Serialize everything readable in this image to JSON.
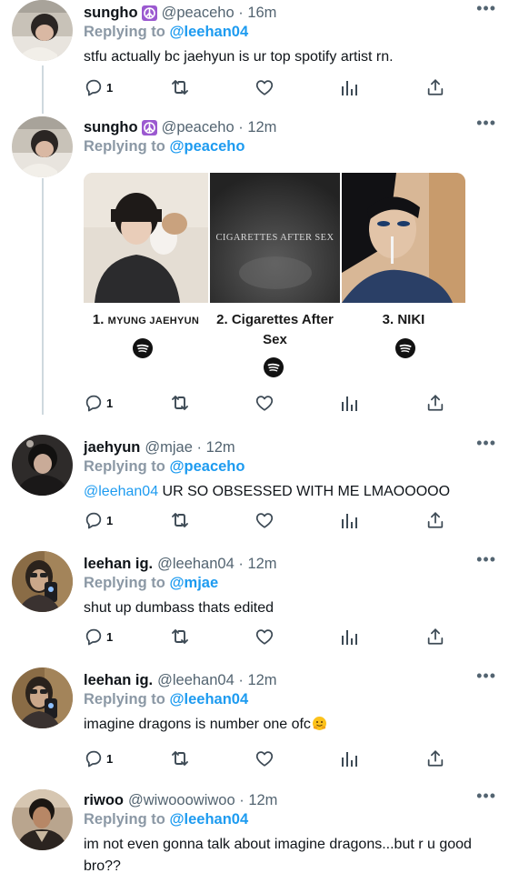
{
  "tweets": [
    {
      "display_name": "sungho",
      "badge_icon": "peace-emoji-icon",
      "handle": "@peaceho",
      "time": "16m",
      "replying_label": "Replying to",
      "replying_to": "@leehan04",
      "text": "stfu actually bc jaehyun is ur top spotify artist rn.",
      "reply_count": "1"
    },
    {
      "display_name": "sungho",
      "badge_icon": "peace-emoji-icon",
      "handle": "@peaceho",
      "time": "12m",
      "replying_label": "Replying to",
      "replying_to": "@peaceho",
      "reply_count": "1",
      "media": {
        "image_text": "CIGARETTES AFTER SEX",
        "artists": [
          {
            "rank": "1.",
            "name": "MYUNG JAEHYUN"
          },
          {
            "rank": "2.",
            "name": "Cigarettes After Sex"
          },
          {
            "rank": "3.",
            "name": "NIKI"
          }
        ],
        "icon": "spotify-icon"
      }
    },
    {
      "display_name": "jaehyun",
      "handle": "@mjae",
      "time": "12m",
      "replying_label": "Replying to",
      "replying_to": "@peaceho",
      "text_mention": "@leehan04",
      "text": "UR SO OBSESSED WITH ME LMAOOOOO",
      "reply_count": "1"
    },
    {
      "display_name": "leehan ig.",
      "handle": "@leehan04",
      "time": "12m",
      "replying_label": "Replying to",
      "replying_to": "@mjae",
      "text": "shut up dumbass thats edited",
      "reply_count": "1"
    },
    {
      "display_name": "leehan ig.",
      "handle": "@leehan04",
      "time": "12m",
      "replying_label": "Replying to",
      "replying_to": "@leehan04",
      "text": "imagine dragons is number one ofc",
      "text_emoji": "hugging-face-emoji-icon",
      "reply_count": "1"
    },
    {
      "display_name": "riwoo",
      "handle": "@wiwooowiwoo",
      "time": "12m",
      "replying_label": "Replying to",
      "replying_to": "@leehan04",
      "text": "im not even gonna talk about imagine dragons...but r u good bro??"
    }
  ],
  "time_separator": "·",
  "colors": {
    "accent": "#1d9bf0",
    "muted": "#536471",
    "thread_line": "#cfd9de"
  }
}
